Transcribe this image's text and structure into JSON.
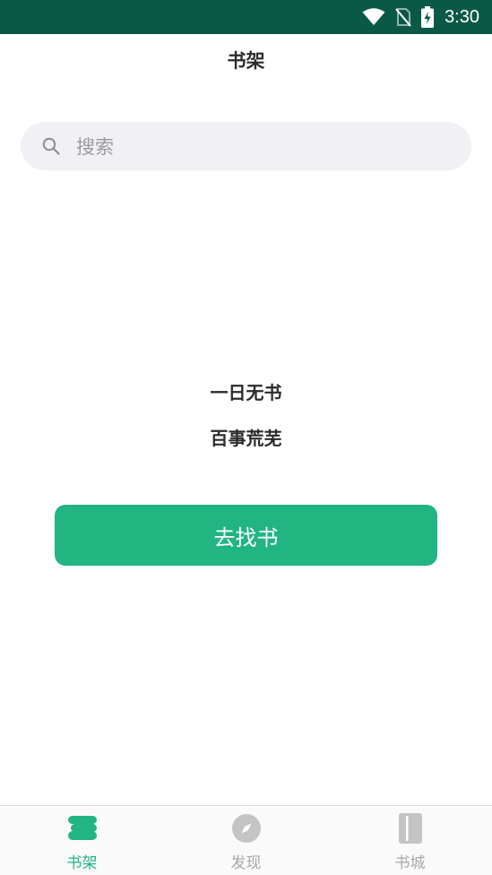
{
  "status_bar": {
    "time": "3:30",
    "wifi_icon": "wifi-icon",
    "signal_icon": "no-signal-icon",
    "battery_icon": "battery-charging-icon",
    "background": "#0a5946"
  },
  "header": {
    "title": "书架"
  },
  "search": {
    "placeholder": "搜索",
    "icon": "search-icon"
  },
  "empty_state": {
    "line1": "一日无书",
    "line2": "百事荒芜",
    "button_label": "去找书",
    "button_color": "#22b582"
  },
  "bottom_nav": {
    "items": [
      {
        "label": "书架",
        "icon": "bookshelf-icon",
        "active": true
      },
      {
        "label": "发现",
        "icon": "compass-icon",
        "active": false
      },
      {
        "label": "书城",
        "icon": "book-icon",
        "active": false
      }
    ],
    "active_color": "#22b582",
    "inactive_color": "#a8a8a8"
  }
}
